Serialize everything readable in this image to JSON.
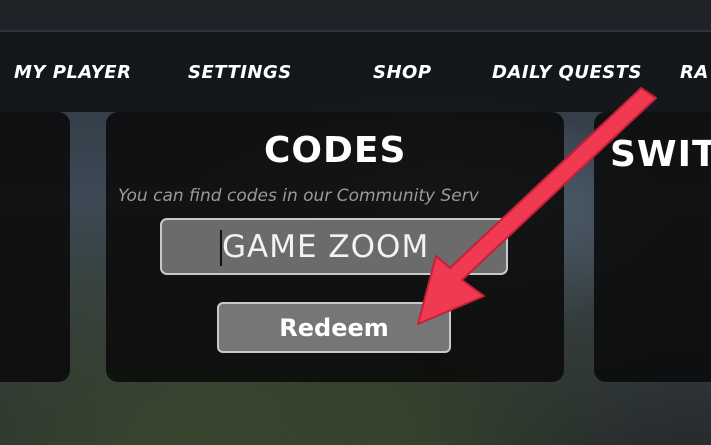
{
  "nav": {
    "items": [
      "MY PLAYER",
      "SETTINGS",
      "SHOP",
      "DAILY QUESTS",
      "RA"
    ]
  },
  "codes_panel": {
    "title": "CODES",
    "subtitle": "You can find codes in our Community Serv",
    "input_value": "GAME ZOOM",
    "redeem_label": "Redeem"
  },
  "right_panel": {
    "title": "SWIT"
  },
  "colors": {
    "annotation_arrow": "#f03a52",
    "panel_bg": "#0a0a0a",
    "input_bg": "#6b6b6b",
    "button_bg": "#767676"
  },
  "icons": [
    "annotation-arrow"
  ]
}
